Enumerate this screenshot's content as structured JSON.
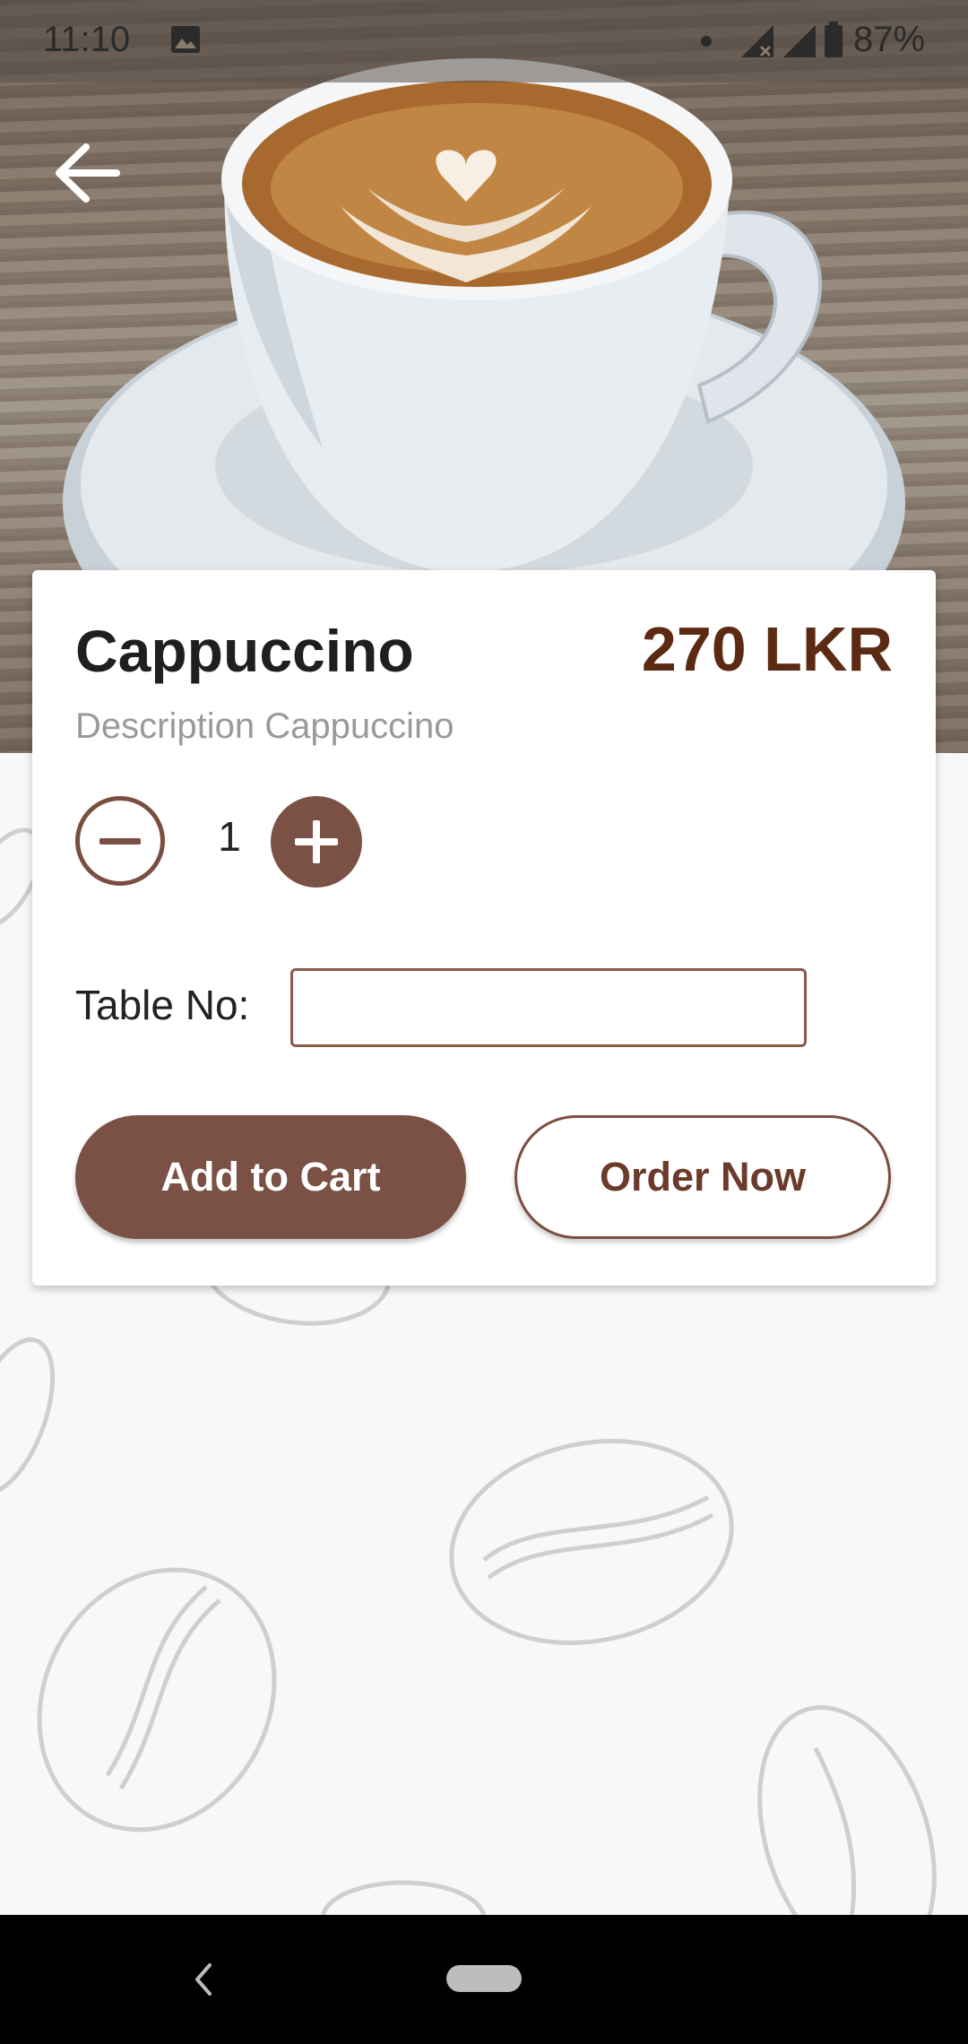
{
  "status_bar": {
    "time": "11:10",
    "battery": "87%",
    "icons": [
      "image-icon",
      "notification-dot-icon",
      "signal-no-data-icon",
      "signal-icon",
      "battery-icon"
    ]
  },
  "hero": {
    "image": "cappuccino-cup-photo",
    "back_icon": "arrow-left-icon"
  },
  "product": {
    "name": "Cappuccino",
    "price": "270 LKR",
    "description": "Description Cappuccino"
  },
  "quantity": {
    "value": "1",
    "minus_icon": "minus-circle-icon",
    "plus_icon": "plus-circle-icon"
  },
  "table": {
    "label": "Table No:",
    "value": "",
    "placeholder": ""
  },
  "actions": {
    "add_to_cart": "Add to Cart",
    "order_now": "Order Now"
  },
  "colors": {
    "accent": "#7a5144",
    "price": "#5c2a12",
    "description": "#9a9a9a"
  },
  "nav_bar": {
    "back_icon": "chevron-left-icon",
    "home_icon": "home-pill-icon"
  }
}
